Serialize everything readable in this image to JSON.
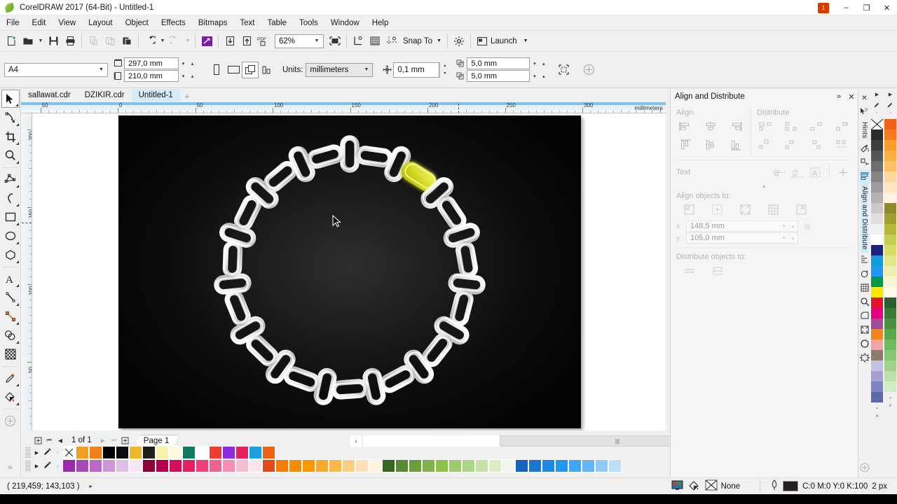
{
  "app": {
    "title": "CorelDRAW 2017 (64-Bit) - Untitled-1",
    "logo_icon": "coreldraw-balloon-icon",
    "notification_count": "1"
  },
  "window_controls": {
    "minimize": "–",
    "maximize": "❐",
    "close": "✕"
  },
  "menubar": {
    "items": [
      {
        "label": "File"
      },
      {
        "label": "Edit"
      },
      {
        "label": "View"
      },
      {
        "label": "Layout"
      },
      {
        "label": "Object"
      },
      {
        "label": "Effects"
      },
      {
        "label": "Bitmaps"
      },
      {
        "label": "Text"
      },
      {
        "label": "Table"
      },
      {
        "label": "Tools"
      },
      {
        "label": "Window"
      },
      {
        "label": "Help"
      }
    ]
  },
  "standard_toolbar": {
    "buttons": [
      {
        "name": "new-document-button",
        "glyph": "new"
      },
      {
        "name": "open-document-button",
        "glyph": "open"
      },
      {
        "name": "save-document-button",
        "glyph": "save"
      },
      {
        "name": "print-button",
        "glyph": "print"
      },
      {
        "name": "cut-button",
        "glyph": "cut",
        "disabled": true
      },
      {
        "name": "copy-button",
        "glyph": "copy",
        "disabled": true
      },
      {
        "name": "paste-button",
        "glyph": "paste",
        "disabled": false
      },
      {
        "name": "undo-button",
        "glyph": "undo"
      },
      {
        "name": "redo-button",
        "glyph": "redo",
        "disabled": true
      },
      {
        "name": "corel-connect-button",
        "glyph": "connect"
      },
      {
        "name": "import-button",
        "glyph": "import"
      },
      {
        "name": "export-button",
        "glyph": "export"
      },
      {
        "name": "publish-pdf-button",
        "glyph": "pdf"
      }
    ],
    "zoom_level": "62%",
    "zoom_placeholder": "62%",
    "full_screen_label": "full-screen-preview",
    "snap_to_label": "Snap To",
    "options_label": "options-gear",
    "launch_label": "Launch"
  },
  "property_bar": {
    "paper_type": "A4",
    "page_width": "297,0 mm",
    "page_height": "210,0 mm",
    "orientation_portrait": "portrait-icon",
    "orientation_landscape": "landscape-icon",
    "all_pages_icon": "all-pages-icon",
    "current_page_icon": "current-page-icon",
    "units_label": "Units:",
    "units_value": "millimeters",
    "nudge_value": "0,1 mm",
    "duplicate_x": "5,0 mm",
    "duplicate_y": "5,0 mm",
    "bleed_icon": "page-border-icon",
    "plus_icon": "add-icon"
  },
  "document_tabs": {
    "tabs": [
      {
        "label": "sallawat.cdr",
        "active": false
      },
      {
        "label": "DZIKIR.cdr",
        "active": false
      },
      {
        "label": "Untitled-1",
        "active": true
      }
    ],
    "new_tab": "+"
  },
  "toolbox": {
    "tools": [
      {
        "name": "pick-tool",
        "label": "Pick",
        "active": true
      },
      {
        "name": "shape-tool",
        "label": "Shape"
      },
      {
        "name": "crop-tool",
        "label": "Crop"
      },
      {
        "name": "zoom-tool",
        "label": "Zoom"
      },
      {
        "name": "freehand-tool",
        "label": "Freehand"
      },
      {
        "name": "smart-drawing-tool",
        "label": "Smart Drawing"
      },
      {
        "name": "rectangle-tool",
        "label": "Rectangle"
      },
      {
        "name": "ellipse-tool",
        "label": "Ellipse"
      },
      {
        "name": "polygon-tool",
        "label": "Polygon"
      },
      {
        "name": "text-tool",
        "label": "Text"
      },
      {
        "name": "parallel-dimension-tool",
        "label": "Parallel Dimension"
      },
      {
        "name": "straight-line-connector-tool",
        "label": "Straight-Line Connector"
      },
      {
        "name": "drop-shadow-tool",
        "label": "Drop Shadow"
      },
      {
        "name": "transparency-tool",
        "label": "Transparency"
      },
      {
        "name": "color-eyedropper-tool",
        "label": "Color Eyedropper"
      },
      {
        "name": "interactive-fill-tool",
        "label": "Interactive Fill"
      },
      {
        "name": "quick-customize-tool",
        "label": "Quick Customize"
      }
    ]
  },
  "rulers": {
    "units_caption": "millimeters",
    "h_labels": [
      "50",
      "0",
      "50",
      "100",
      "150",
      "200",
      "250",
      "300"
    ],
    "v_labels": [
      "200",
      "150",
      "100",
      "50"
    ]
  },
  "canvas": {
    "page_background": "#0a0a0a",
    "artwork_name": "chain-necklace-artwork",
    "highlighted_link_color": "#d6dd2a",
    "cursor": "arrow-cursor"
  },
  "page_navigator": {
    "first": "first-page-icon",
    "prev": "previous-page-icon",
    "next": "next-page-icon",
    "last": "last-page-icon",
    "add_before": "add-page-before-icon",
    "add_after": "add-page-after-icon",
    "counter": "1 of 1",
    "page_tab": "Page 1"
  },
  "horizontal_scrollbar": {
    "left_arrow": "‹",
    "right_arrow": "›",
    "thumb_grip": "|||",
    "zoom_icon": "zoom-to-fit-icon"
  },
  "vertical_scrollbar": {
    "up_arrow": "▲",
    "down_arrow": "▼"
  },
  "docker": {
    "title": "Align and Distribute",
    "expand_icon": "»",
    "close_icon": "✕",
    "align_label": "Align",
    "distribute_label": "Distribute",
    "text_label": "Text",
    "align_objects_to_label": "Align objects to:",
    "distribute_objects_to_label": "Distribute objects to:",
    "x_value": "148,5 mm",
    "y_value": "105,0 mm",
    "collapse_icon": "▲",
    "align_buttons": [
      "align-left",
      "align-center-horizontal",
      "align-right",
      "align-top",
      "align-center-vertical",
      "align-bottom"
    ],
    "distribute_buttons": [
      "distribute-left",
      "distribute-center-h",
      "distribute-spacing-h",
      "distribute-right",
      "distribute-top",
      "distribute-center-v",
      "distribute-spacing-v",
      "distribute-bottom"
    ],
    "text_buttons": [
      "text-first-line-baseline",
      "text-last-line-baseline",
      "text-bounding-box",
      "text-outline"
    ],
    "align_to_buttons": [
      "active-object",
      "page-edge",
      "page-center",
      "grid",
      "specified-point"
    ],
    "distribute_to_buttons": [
      "extent-of-selection",
      "extent-of-page"
    ]
  },
  "right_tabs": {
    "items": [
      {
        "name": "hints-tab",
        "label": "Hints",
        "selected": false
      },
      {
        "name": "align-distribute-tab",
        "label": "Align and Distribute",
        "selected": true
      }
    ],
    "icons": [
      "close-icon",
      "pointer-help-icon",
      "object-properties-icon",
      "transformations-icon",
      "align-icon",
      "arrow-icon",
      "steps-repeat-icon",
      "lens-icon",
      "grid-icon",
      "find-icon",
      "shape-icon",
      "frame-icon",
      "ellipse-icon",
      "symbol-icon",
      "plus-icon"
    ]
  },
  "status_bar": {
    "coordinates": "( 219,459; 143,103 )",
    "expand_caret": "▸",
    "color_proof_icon": "color-proof-icon",
    "fill_icon": "fill-icon",
    "fill_value": "None",
    "outline_icon": "outline-pen-icon",
    "outline_color_hex": "#231f20",
    "outline_value": "C:0 M:0 Y:0 K:100",
    "outline_width": "2 px"
  },
  "palettes": {
    "row1": [
      "none",
      "#f0a020",
      "#ef7f1a",
      "#000000",
      "#0c0c0c",
      "#f0b72a",
      "#221c18",
      "#f6f2a8",
      "#fbf8dc",
      "#0e7a5f",
      "#ffffff",
      "#ee3b33",
      "#8a2be2",
      "#e91e63",
      "#1e9fe0",
      "#ef6114"
    ],
    "row2": [
      "#9c27b0",
      "#ab47bc",
      "#ba68c8",
      "#ce93d8",
      "#e1bee7",
      "#f3e5f5",
      "#8e0038",
      "#b4004e",
      "#d40d5f",
      "#e91e63",
      "#ec407a",
      "#f06292",
      "#f48fb1",
      "#f8bbd0",
      "#fce4ec",
      "#e64a19",
      "#f57c00",
      "#fb8c00",
      "#ff9800",
      "#ffa726",
      "#ffb74d",
      "#ffcc80",
      "#ffe0b2",
      "#fff3e0",
      "#33691e",
      "#558b2f",
      "#689f38",
      "#7cb342",
      "#8bc34a",
      "#9ccc65",
      "#aed581",
      "#c5e1a5",
      "#dcedc8",
      "#f1f8e9",
      "#1565c0",
      "#1976d2",
      "#1e88e5",
      "#2196f3",
      "#42a5f5",
      "#64b5f6",
      "#90caf9",
      "#bbdefb"
    ],
    "right_col1": [
      "none",
      "#2b2b2b",
      "#3d3d3d",
      "#555555",
      "#6e6e6e",
      "#858585",
      "#9c9c9c",
      "#b3b3b3",
      "#c9c9c9",
      "#dedede",
      "#f0f0f0",
      "#ffffff",
      "#1a237e",
      "#0d9ddb",
      "#2196f3",
      "#009a49",
      "#ffe800",
      "#e8112d",
      "#e6007e",
      "#a14b9a",
      "#f58220",
      "#f2a3a3",
      "#8d7b70",
      "#c5c1e0",
      "#a79fd4",
      "#7c84c4",
      "#5d6aa8"
    ],
    "right_col2": [
      "#ef6114",
      "#f47b20",
      "#f99d2a",
      "#fbb040",
      "#fcc26a",
      "#fdd79f",
      "#fde7c3",
      "#fef3e0",
      "#8d8a2b",
      "#a0a02e",
      "#b4b83a",
      "#c7cd50",
      "#d6dd6a",
      "#e2e68c",
      "#ecefb0",
      "#f5f7d5",
      "#fbfce9",
      "#2e5e2e",
      "#3a7a34",
      "#4a9140",
      "#5aa84c",
      "#6fbb5c",
      "#86c871",
      "#a0d48c",
      "#bbe0aa",
      "#d5ecc8"
    ]
  }
}
